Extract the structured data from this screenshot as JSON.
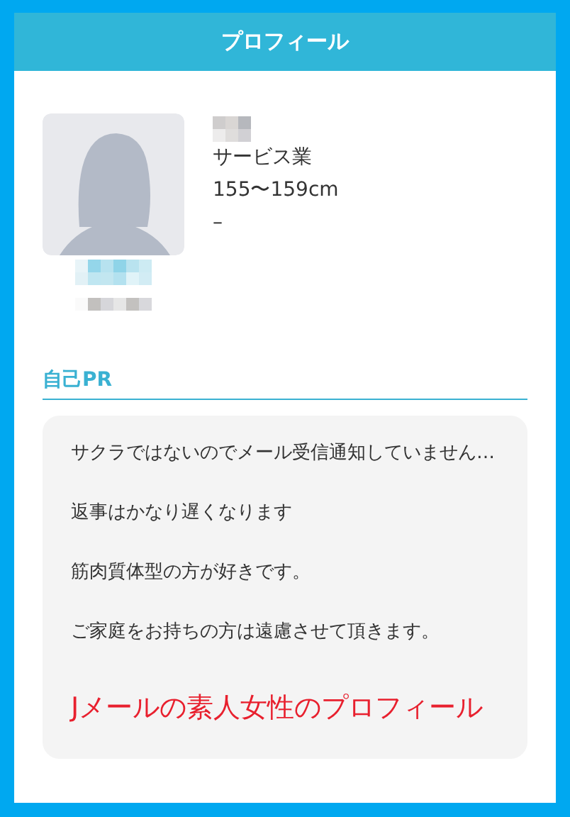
{
  "header": {
    "title": "プロフィール"
  },
  "profile": {
    "details": [
      "サービス業",
      "155〜159cm",
      "–"
    ]
  },
  "self_pr": {
    "title": "自己PR",
    "paragraphs": [
      "サクラではないのでメール受信通知していません…",
      "返事はかなり遅くなります",
      "筋肉質体型の方が好きです。",
      "ご家庭をお持ちの方は遠慮させて頂きます。"
    ],
    "highlight": "Jメールの素人女性のプロフィール"
  }
}
